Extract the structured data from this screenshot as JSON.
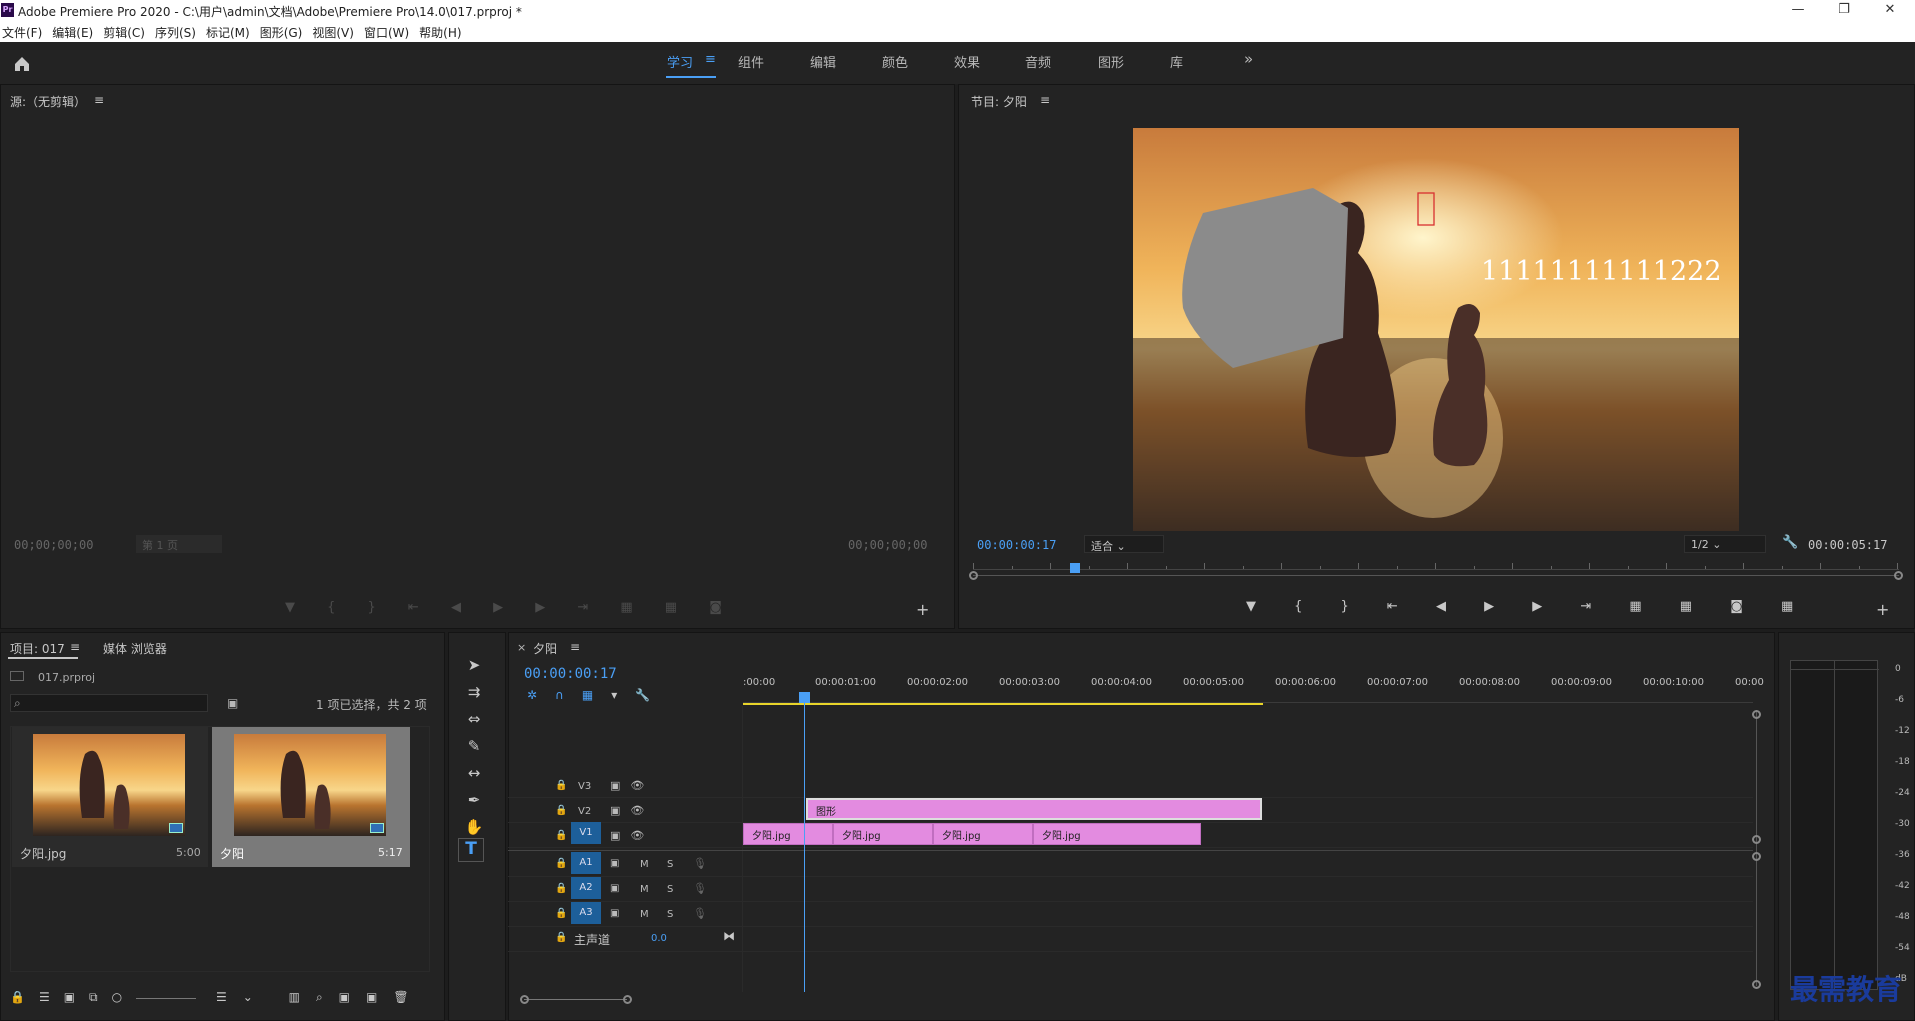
{
  "app": {
    "title": "Adobe Premiere Pro 2020 - C:\\用户\\admin\\文档\\Adobe\\Premiere Pro\\14.0\\017.prproj *",
    "logo": "Pr",
    "minimize": "—",
    "maximize": "❐",
    "close": "✕"
  },
  "menu": [
    "文件(F)",
    "编辑(E)",
    "剪辑(C)",
    "序列(S)",
    "标记(M)",
    "图形(G)",
    "视图(V)",
    "窗口(W)",
    "帮助(H)"
  ],
  "workspaces": {
    "items": [
      "学习",
      "组件",
      "编辑",
      "颜色",
      "效果",
      "音频",
      "图形",
      "库"
    ],
    "active": "学习",
    "menu_icon": "≡",
    "more": "»"
  },
  "source": {
    "title": "源:（无剪辑）",
    "menu_icon": "≡",
    "timecode_in": "00;00;00;00",
    "timecode_out": "00;00;00;00",
    "page": "第 1 页"
  },
  "program": {
    "title": "节目: 夕阳",
    "menu_icon": "≡",
    "timecode": "00:00:00:17",
    "fit": "适合",
    "resolution": "1/2",
    "duration": "00:00:05:17",
    "overlay_text": "11111111111222",
    "playhead_fraction": 0.11
  },
  "project": {
    "title": "项目: 017",
    "menu_icon": "≡",
    "browser_tab": "媒体 浏览器",
    "file": "017.prproj",
    "selection": "1 项已选择，共 2 项",
    "items": [
      {
        "name": "夕阳.jpg",
        "duration": "5:00"
      },
      {
        "name": "夕阳",
        "duration": "5:17"
      }
    ]
  },
  "timeline": {
    "title": "夕阳",
    "close": "×",
    "menu_icon": "≡",
    "timecode": "00:00:00:17",
    "ruler": [
      ":00:00",
      "00:00:01:00",
      "00:00:02:00",
      "00:00:03:00",
      "00:00:04:00",
      "00:00:05:00",
      "00:00:06:00",
      "00:00:07:00",
      "00:00:08:00",
      "00:00:09:00",
      "00:00:10:00",
      "00:00"
    ],
    "video_tracks": [
      "V3",
      "V2",
      "V1"
    ],
    "audio_tracks": [
      "A1",
      "A2",
      "A3"
    ],
    "master": {
      "label": "主声道",
      "value": "0.0"
    },
    "m": "M",
    "s": "S",
    "clips_v2": [
      {
        "label": "图形"
      }
    ],
    "clips_v1": [
      {
        "label": "夕阳.jpg"
      },
      {
        "label": "夕阳.jpg"
      },
      {
        "label": "夕阳.jpg"
      },
      {
        "label": "夕阳.jpg"
      }
    ]
  },
  "meter": {
    "labels": [
      "0",
      "-6",
      "-12",
      "-18",
      "-24",
      "-30",
      "-36",
      "-42",
      "-48",
      "-54",
      "dB"
    ]
  },
  "watermark": "最需教育",
  "colors": {
    "accent": "#4a9ff5",
    "clip": "#e38be0",
    "track_btn": "#1d5f9a",
    "work_area": "#e8d42a"
  }
}
